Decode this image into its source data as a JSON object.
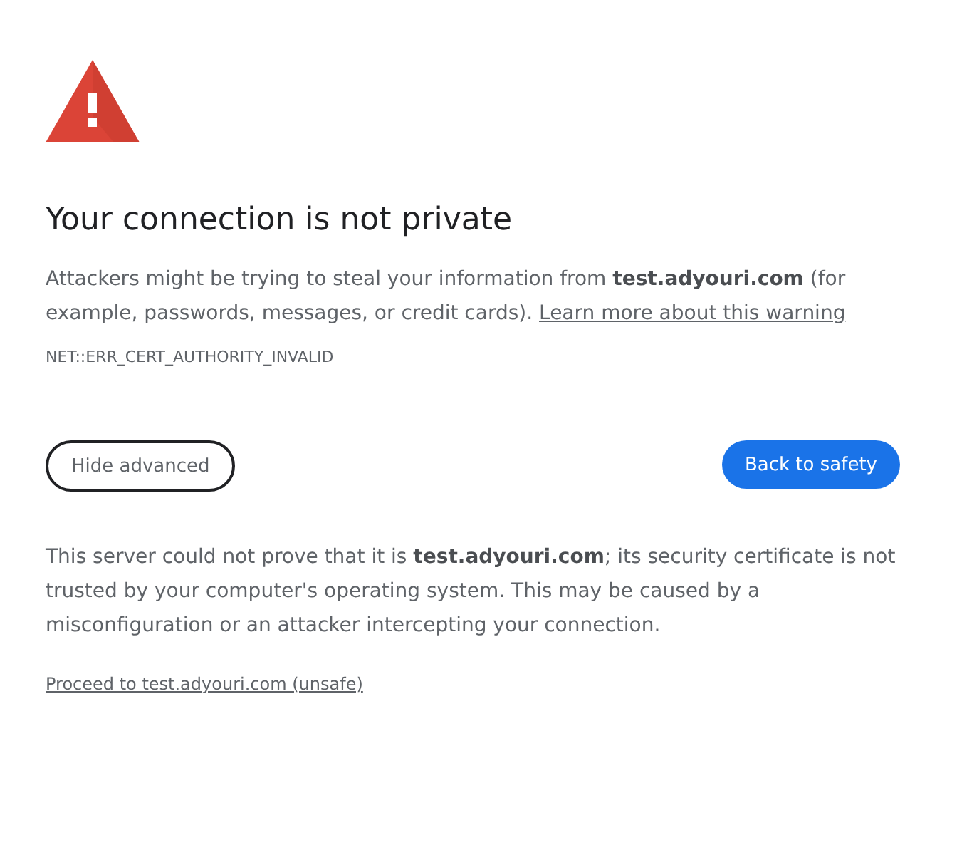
{
  "heading": "Your connection is not private",
  "summary": {
    "text": "Attackers might be trying to steal your information from **test.adyouri.com** (for example, passwords, messages, or credit cards).",
    "link": "Learn more about this warning"
  },
  "error_code": "NET::ERR_CERT_AUTHORITY_INVALID",
  "buttons": [
    {
      "label": "Hide advanced",
      "kind": "secondary"
    },
    {
      "label": "Back to safety",
      "kind": "primary"
    }
  ],
  "details": "This server could not prove that it is **test.adyouri.com**; its security certificate is not trusted by your computer's operating system. This may be caused by a misconfiguration or an attacker intercepting your connection.",
  "proceed_link": "Proceed to test.adyouri.com (unsafe)"
}
